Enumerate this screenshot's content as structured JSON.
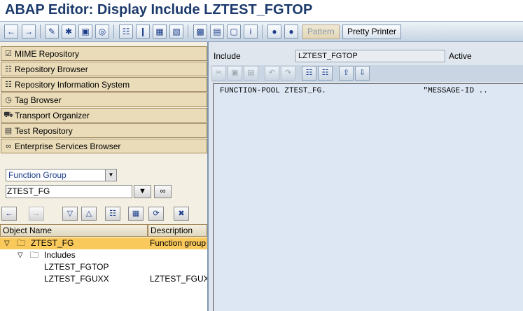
{
  "title": "ABAP Editor: Display Include LZTEST_FGTOP",
  "toolbar": {
    "pattern_label": "Pattern",
    "pretty_printer_label": "Pretty Printer"
  },
  "nav": [
    {
      "label": "MIME Repository",
      "icon": "mime-icon"
    },
    {
      "label": "Repository Browser",
      "icon": "tree-icon"
    },
    {
      "label": "Repository Information System",
      "icon": "info-system-icon"
    },
    {
      "label": "Tag Browser",
      "icon": "tag-icon"
    },
    {
      "label": "Transport Organizer",
      "icon": "truck-icon"
    },
    {
      "label": "Test Repository",
      "icon": "test-icon"
    },
    {
      "label": "Enterprise Services Browser",
      "icon": "services-icon"
    }
  ],
  "object_type": "Function Group",
  "object_name_value": "ZTEST_FG",
  "tree": {
    "columns": [
      "Object Name",
      "Description"
    ],
    "rows": [
      {
        "name": "ZTEST_FG",
        "desc": "Function group"
      },
      {
        "name": "Includes",
        "desc": ""
      },
      {
        "name": "LZTEST_FGTOP",
        "desc": ""
      },
      {
        "name": "LZTEST_FGUXX",
        "desc": "LZTEST_FGUX"
      }
    ]
  },
  "include": {
    "label": "Include",
    "value": "LZTEST_FGTOP",
    "status": "Active"
  },
  "code": "FUNCTION-POOL ZTEST_FG.                     \"MESSAGE-ID .."
}
